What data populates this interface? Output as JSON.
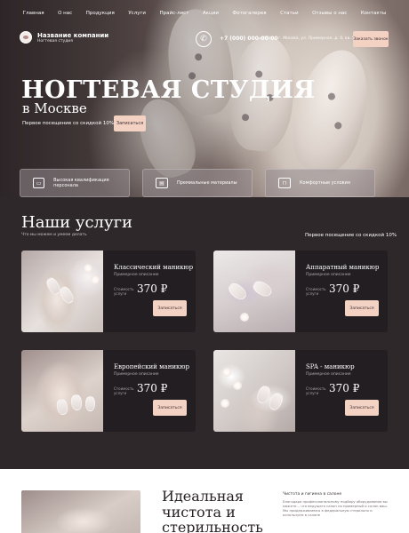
{
  "nav": [
    "Главная",
    "О нас",
    "Продукция",
    "Услуги",
    "Прайс-лист",
    "Акции",
    "Фотогалерея",
    "Статьи",
    "Отзывы о нас",
    "Контакты"
  ],
  "brand": {
    "name": "Название компании",
    "subtitle": "Ногтевая студия"
  },
  "contact": {
    "phone": "+7 (000) 000-00-00",
    "address": "г. Москва, ул. Примерная, д. 4, кв. 5",
    "call_button": "Заказать звонок"
  },
  "hero": {
    "title": "НОГТЕВАЯ СТУДИЯ",
    "subtitle": "в Москве",
    "offer": "Первое посещение со скидкой 10%",
    "button": "Записаться"
  },
  "features": [
    {
      "icon": "certificate-icon",
      "text": "Высокая квалификация персонала"
    },
    {
      "icon": "cosmetics-icon",
      "text": "Премиальные материалы"
    },
    {
      "icon": "armchair-icon",
      "text": "Комфортные условия"
    }
  ],
  "services": {
    "title": "Наши услуги",
    "subtitle": "Что мы можем и умеем делать",
    "promo": "Первое посещение со скидкой 10%",
    "items": [
      {
        "name": "Классический маникюр",
        "desc": "Примерное описание",
        "price_label": "Стоимость услуги",
        "price": "370 ₽",
        "button": "Записаться"
      },
      {
        "name": "Аппаратный маникюр",
        "desc": "Примерное описание",
        "price_label": "Стоимость услуги",
        "price": "370 ₽",
        "button": "Записаться"
      },
      {
        "name": "Европейский маникюр",
        "desc": "Примерное описание",
        "price_label": "Стоимость услуги",
        "price": "370 ₽",
        "button": "Записаться"
      },
      {
        "name": "SPA - маникюр",
        "desc": "Примерное описание",
        "price_label": "Стоимость услуги",
        "price": "370 ₽",
        "button": "Записаться"
      }
    ]
  },
  "cleanliness": {
    "title": "Идеальная чистота и стерильность",
    "subtitle": "Чистота и гигиена в салоне",
    "text": "Благодаря профессиональному подбору оборудования вы можете... что ведущего салон на примерный и салон ваш. Мы придерживаемся в федеральную стерильно и используем в салоне"
  },
  "colors": {
    "accent": "#f3d2c4",
    "dark_bg": "#2e282b",
    "card_bg": "#231e21"
  }
}
